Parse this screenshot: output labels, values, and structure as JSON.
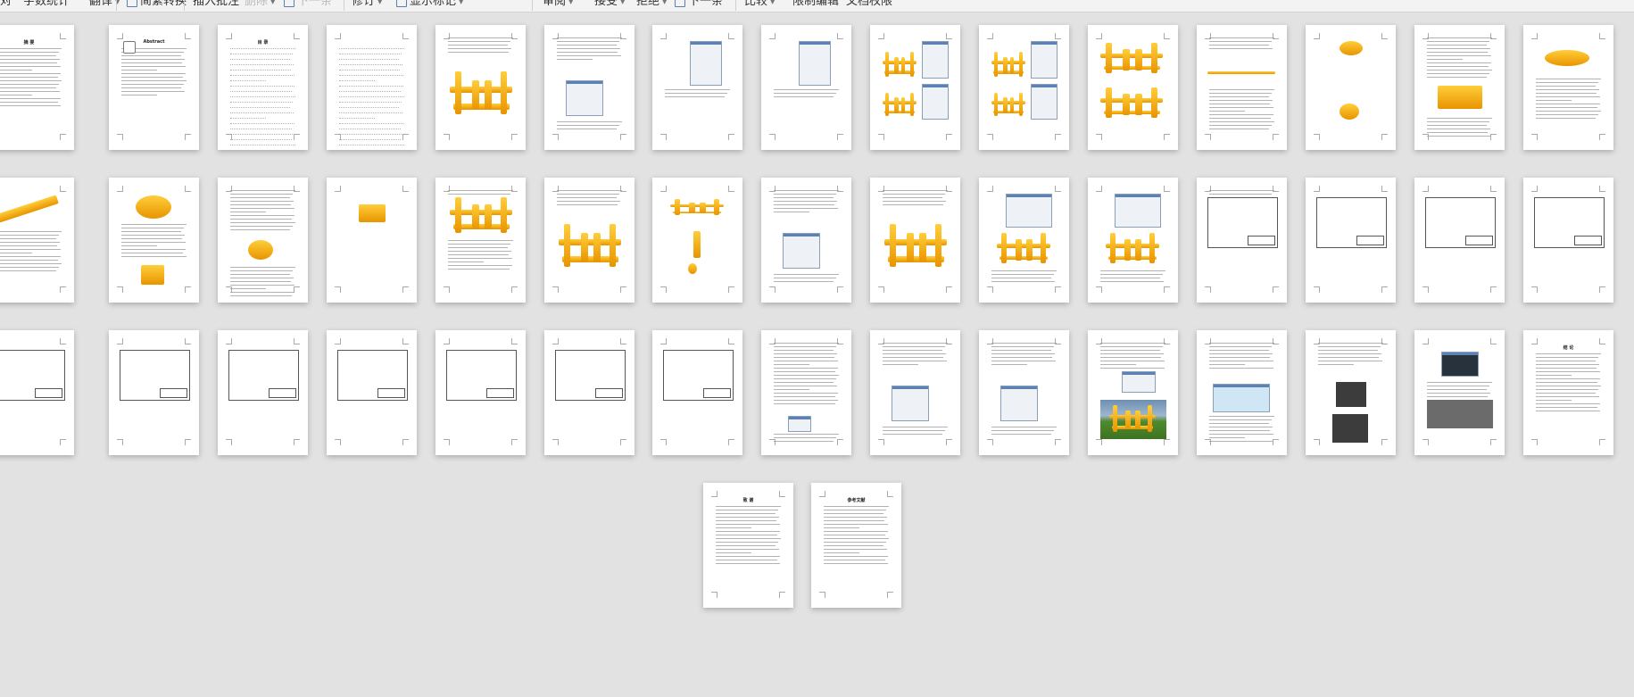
{
  "toolbar": {
    "items": [
      {
        "label": "对",
        "caret": false,
        "disabled": false
      },
      {
        "label": "字数统计",
        "caret": false,
        "disabled": false
      },
      {
        "label": "翻译",
        "caret": true,
        "disabled": false
      },
      {
        "label": "简繁转换",
        "caret": false,
        "disabled": false
      },
      {
        "label": "插入批注",
        "caret": false,
        "disabled": false
      },
      {
        "label": "删除",
        "caret": true,
        "disabled": true
      },
      {
        "label": "下一条",
        "caret": false,
        "disabled": true
      },
      {
        "label": "修订",
        "caret": true,
        "disabled": false
      },
      {
        "label": "显示标记",
        "caret": true,
        "disabled": false
      },
      {
        "label": "审阅",
        "caret": true,
        "disabled": false
      },
      {
        "label": "接受",
        "caret": true,
        "disabled": false
      },
      {
        "label": "拒绝",
        "caret": true,
        "disabled": false
      },
      {
        "label": "下一条",
        "caret": false,
        "disabled": false
      },
      {
        "label": "比较",
        "caret": true,
        "disabled": false
      },
      {
        "label": "限制编辑",
        "caret": false,
        "disabled": false
      },
      {
        "label": "文档权限",
        "caret": false,
        "disabled": false
      }
    ]
  },
  "pages": [
    {
      "title": "摘 要",
      "kind": "text"
    },
    {
      "title": "Abstract",
      "kind": "abstract"
    },
    {
      "title": "目 录",
      "kind": "toc"
    },
    {
      "title": "",
      "kind": "toc"
    },
    {
      "title": "",
      "kind": "model-text"
    },
    {
      "title": "",
      "kind": "dialog-text"
    },
    {
      "title": "",
      "kind": "dialog"
    },
    {
      "title": "",
      "kind": "dialog"
    },
    {
      "title": "",
      "kind": "model-dialog"
    },
    {
      "title": "",
      "kind": "model-dialog"
    },
    {
      "title": "",
      "kind": "model2"
    },
    {
      "title": "",
      "kind": "rod-text"
    },
    {
      "title": "",
      "kind": "parts"
    },
    {
      "title": "",
      "kind": "block-text"
    },
    {
      "title": "",
      "kind": "cylinder-text"
    },
    {
      "title": "",
      "kind": "link-text"
    },
    {
      "title": "",
      "kind": "parts2"
    },
    {
      "title": "",
      "kind": "text-part"
    },
    {
      "title": "",
      "kind": "small-part"
    },
    {
      "title": "",
      "kind": "model-text2"
    },
    {
      "title": "",
      "kind": "model-text"
    },
    {
      "title": "",
      "kind": "exploded"
    },
    {
      "title": "",
      "kind": "dialog-text"
    },
    {
      "title": "",
      "kind": "model-text"
    },
    {
      "title": "",
      "kind": "dialog-model"
    },
    {
      "title": "",
      "kind": "dialog-model"
    },
    {
      "title": "",
      "kind": "drawing-text"
    },
    {
      "title": "",
      "kind": "drawing"
    },
    {
      "title": "",
      "kind": "drawing"
    },
    {
      "title": "",
      "kind": "drawing"
    },
    {
      "title": "",
      "kind": "drawing"
    },
    {
      "title": "",
      "kind": "drawing"
    },
    {
      "title": "",
      "kind": "drawing"
    },
    {
      "title": "",
      "kind": "drawing"
    },
    {
      "title": "",
      "kind": "drawing"
    },
    {
      "title": "",
      "kind": "drawing"
    },
    {
      "title": "",
      "kind": "drawing"
    },
    {
      "title": "",
      "kind": "text-dialog"
    },
    {
      "title": "",
      "kind": "dialog-text"
    },
    {
      "title": "",
      "kind": "dialog-text"
    },
    {
      "title": "",
      "kind": "text-photo"
    },
    {
      "title": "",
      "kind": "text-cube"
    },
    {
      "title": "",
      "kind": "text-dark"
    },
    {
      "title": "",
      "kind": "photo-text"
    },
    {
      "title": "结 论",
      "kind": "text"
    },
    {
      "title": "致 谢",
      "kind": "text"
    },
    {
      "title": "参考文献",
      "kind": "text"
    }
  ],
  "colors": {
    "background": "#e2e2e2",
    "model": "#f2a500",
    "dialog_title": "#5a82b6"
  }
}
